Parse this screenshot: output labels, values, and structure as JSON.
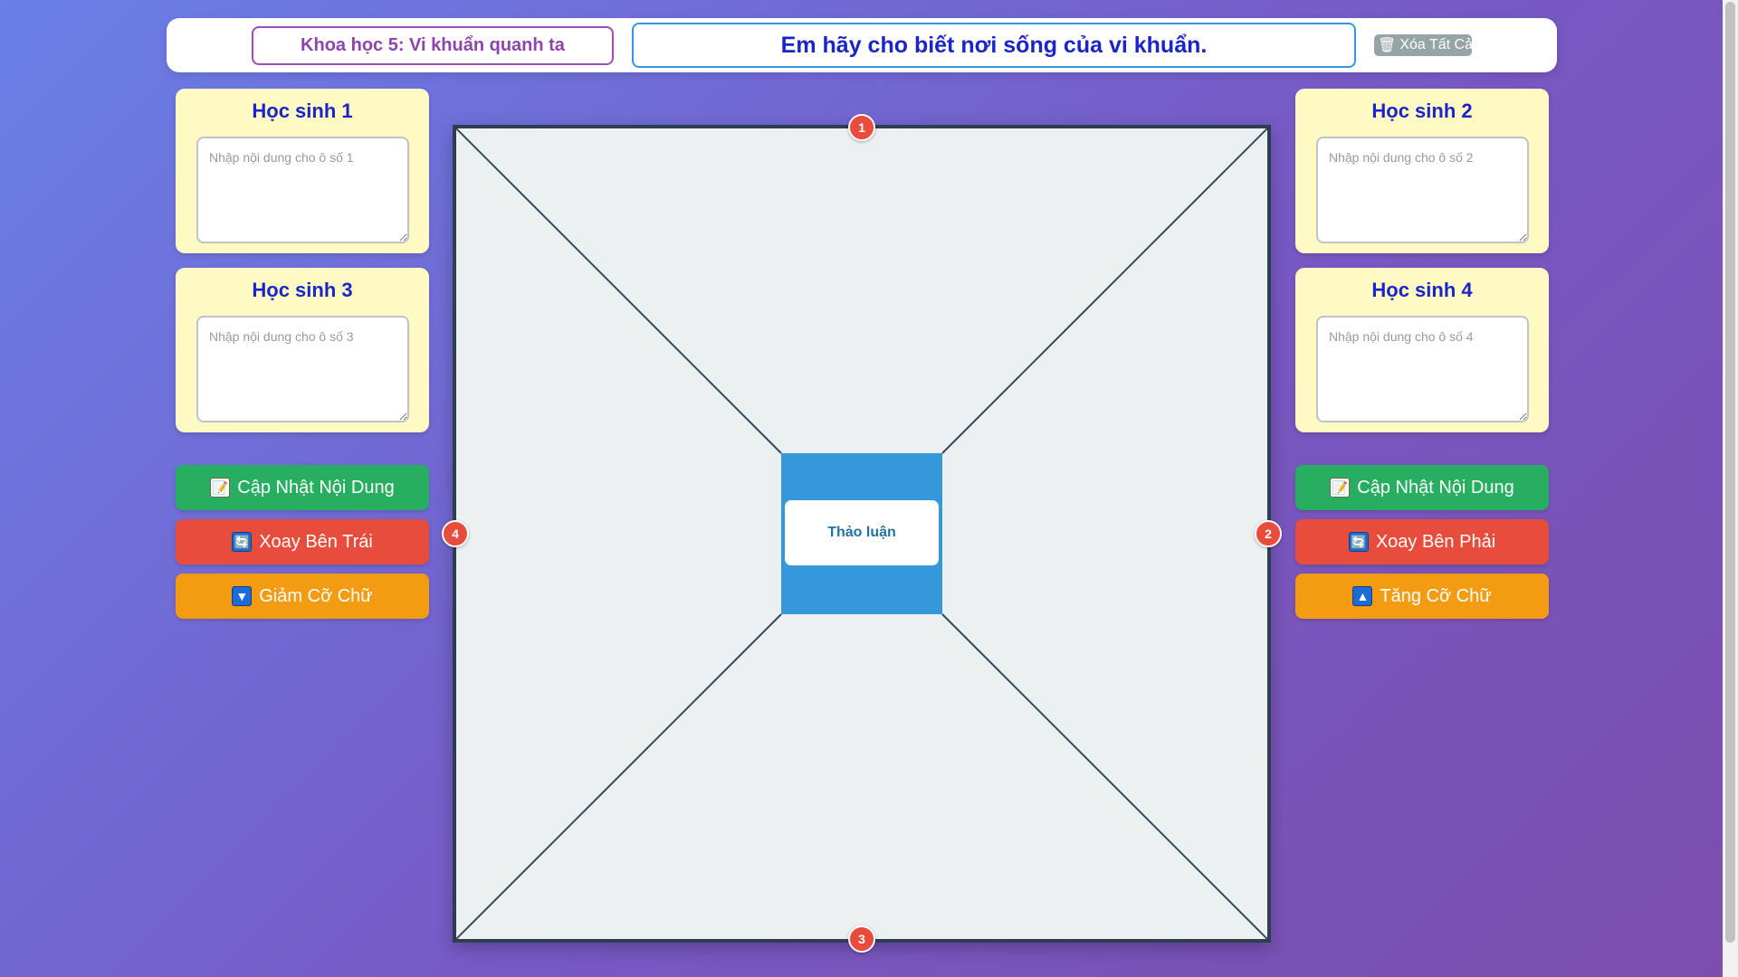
{
  "header": {
    "subject_title": "Khoa học 5: Vi khuẩn quanh ta",
    "question": "Em hãy cho biết nơi sống của vi khuẩn.",
    "clear_all_label": "Xóa Tất Cả",
    "clear_all_icon": "🗑"
  },
  "students": [
    {
      "title": "Học sinh 1",
      "placeholder": "Nhập nội dung cho ô số 1"
    },
    {
      "title": "Học sinh 2",
      "placeholder": "Nhập nội dung cho ô số 2"
    },
    {
      "title": "Học sinh 3",
      "placeholder": "Nhập nội dung cho ô số 3"
    },
    {
      "title": "Học sinh 4",
      "placeholder": "Nhập nội dung cho ô số 4"
    }
  ],
  "left_actions": {
    "update_label": "Cập Nhật Nội Dung",
    "update_icon": "📝",
    "rotate_label": "Xoay Bên Trái",
    "rotate_icon": "🔄",
    "font_label": "Giảm Cỡ Chữ",
    "font_icon": "▼"
  },
  "right_actions": {
    "update_label": "Cập Nhật Nội Dung",
    "update_icon": "📝",
    "rotate_label": "Xoay Bên Phải",
    "rotate_icon": "🔄",
    "font_label": "Tăng Cỡ Chữ",
    "font_icon": "▲"
  },
  "board": {
    "center_label": "Thảo luận",
    "badges": [
      "1",
      "2",
      "3",
      "4"
    ]
  },
  "colors": {
    "subject_border": "#9b4fb3",
    "question_border": "#3498db",
    "card_bg": "#fff9c4",
    "green": "#27ae60",
    "red": "#e74c3c",
    "orange": "#f39c12",
    "center": "#3498db"
  }
}
